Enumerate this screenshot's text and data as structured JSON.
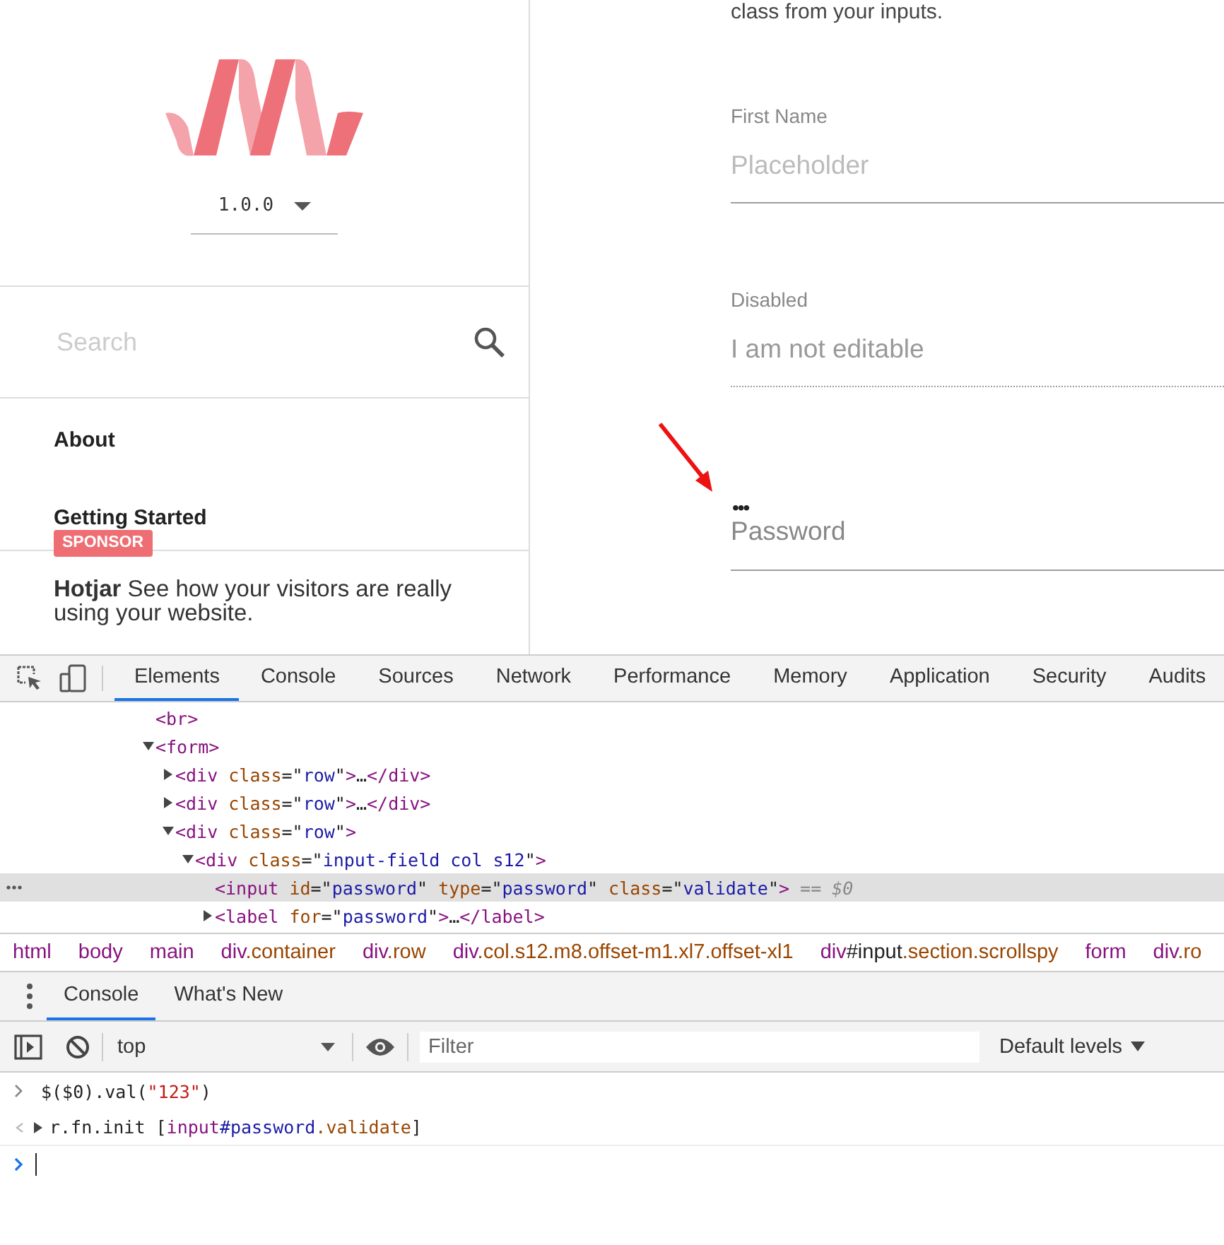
{
  "page": {
    "intro": "class from your inputs.",
    "version": "1.0.0",
    "search": {
      "placeholder": "Search"
    },
    "nav": [
      {
        "label": "About"
      },
      {
        "label": "Getting Started"
      }
    ],
    "sponsor": {
      "badge": "SPONSOR",
      "name": "Hotjar",
      "text": "See how your visitors are really using your website."
    },
    "fields": [
      {
        "kind": "text",
        "label": "First Name",
        "placeholder": "Placeholder",
        "disabled": false
      },
      {
        "kind": "text",
        "label": "Disabled",
        "value": "I am not editable",
        "disabled": true
      },
      {
        "kind": "password",
        "label": "Password",
        "value": "•••",
        "disabled": false
      }
    ]
  },
  "devtools": {
    "tabs": [
      {
        "label": "Elements",
        "selected": true
      },
      {
        "label": "Console",
        "selected": false
      },
      {
        "label": "Sources",
        "selected": false
      },
      {
        "label": "Network",
        "selected": false
      },
      {
        "label": "Performance",
        "selected": false
      },
      {
        "label": "Memory",
        "selected": false
      },
      {
        "label": "Application",
        "selected": false
      },
      {
        "label": "Security",
        "selected": false
      },
      {
        "label": "Audits",
        "selected": false
      }
    ],
    "dom": [
      {
        "selected": false,
        "tokens": [
          {
            "kind": "tag",
            "s": "<br>"
          }
        ]
      },
      {
        "selected": false,
        "expanded": true,
        "tokens": [
          {
            "kind": "tag",
            "s": "<form>"
          }
        ],
        "children": [
          {
            "selected": false,
            "expanded": false,
            "tokens": [
              {
                "kind": "tag",
                "s": "<div "
              },
              {
                "kind": "attr",
                "s": "class"
              },
              {
                "kind": "plain",
                "s": "=\""
              },
              {
                "kind": "value",
                "s": "row"
              },
              {
                "kind": "plain",
                "s": "\""
              },
              {
                "kind": "tag",
                "s": ">"
              },
              {
                "kind": "plain",
                "s": "…"
              },
              {
                "kind": "tag",
                "s": "</div>"
              }
            ]
          },
          {
            "selected": false,
            "expanded": false,
            "tokens": [
              {
                "kind": "tag",
                "s": "<div "
              },
              {
                "kind": "attr",
                "s": "class"
              },
              {
                "kind": "plain",
                "s": "=\""
              },
              {
                "kind": "value",
                "s": "row"
              },
              {
                "kind": "plain",
                "s": "\""
              },
              {
                "kind": "tag",
                "s": ">"
              },
              {
                "kind": "plain",
                "s": "…"
              },
              {
                "kind": "tag",
                "s": "</div>"
              }
            ]
          },
          {
            "selected": false,
            "expanded": true,
            "tokens": [
              {
                "kind": "tag",
                "s": "<div "
              },
              {
                "kind": "attr",
                "s": "class"
              },
              {
                "kind": "plain",
                "s": "=\""
              },
              {
                "kind": "value",
                "s": "row"
              },
              {
                "kind": "plain",
                "s": "\""
              },
              {
                "kind": "tag",
                "s": ">"
              }
            ],
            "children": [
              {
                "selected": false,
                "expanded": true,
                "tokens": [
                  {
                    "kind": "tag",
                    "s": "<div "
                  },
                  {
                    "kind": "attr",
                    "s": "class"
                  },
                  {
                    "kind": "plain",
                    "s": "=\""
                  },
                  {
                    "kind": "value",
                    "s": "input-field col s12"
                  },
                  {
                    "kind": "plain",
                    "s": "\""
                  },
                  {
                    "kind": "tag",
                    "s": ">"
                  }
                ],
                "children": [
                  {
                    "selected": true,
                    "tokens": [
                      {
                        "kind": "tag",
                        "s": "<input "
                      },
                      {
                        "kind": "attr",
                        "s": "id"
                      },
                      {
                        "kind": "plain",
                        "s": "=\""
                      },
                      {
                        "kind": "value",
                        "s": "password"
                      },
                      {
                        "kind": "plain",
                        "s": "\" "
                      },
                      {
                        "kind": "attr",
                        "s": "type"
                      },
                      {
                        "kind": "plain",
                        "s": "=\""
                      },
                      {
                        "kind": "value",
                        "s": "password"
                      },
                      {
                        "kind": "plain",
                        "s": "\" "
                      },
                      {
                        "kind": "attr",
                        "s": "class"
                      },
                      {
                        "kind": "plain",
                        "s": "=\""
                      },
                      {
                        "kind": "value",
                        "s": "validate"
                      },
                      {
                        "kind": "plain",
                        "s": "\""
                      },
                      {
                        "kind": "tag",
                        "s": ">"
                      },
                      {
                        "kind": "ref",
                        "s": " == $0"
                      }
                    ]
                  },
                  {
                    "selected": false,
                    "expanded": false,
                    "tokens": [
                      {
                        "kind": "tag",
                        "s": "<label "
                      },
                      {
                        "kind": "attr",
                        "s": "for"
                      },
                      {
                        "kind": "plain",
                        "s": "=\""
                      },
                      {
                        "kind": "value",
                        "s": "password"
                      },
                      {
                        "kind": "plain",
                        "s": "\""
                      },
                      {
                        "kind": "tag",
                        "s": ">"
                      },
                      {
                        "kind": "plain",
                        "s": "…"
                      },
                      {
                        "kind": "tag",
                        "s": "</label>"
                      }
                    ]
                  }
                ]
              }
            ]
          }
        ]
      }
    ],
    "crumbs": [
      [
        {
          "kind": "tag",
          "s": "html"
        }
      ],
      [
        {
          "kind": "tag",
          "s": "body"
        }
      ],
      [
        {
          "kind": "tag",
          "s": "main"
        }
      ],
      [
        {
          "kind": "tag",
          "s": "div"
        },
        {
          "kind": "attr",
          "s": ".container"
        }
      ],
      [
        {
          "kind": "tag",
          "s": "div"
        },
        {
          "kind": "attr",
          "s": ".row"
        }
      ],
      [
        {
          "kind": "tag",
          "s": "div"
        },
        {
          "kind": "attr",
          "s": ".col.s12.m8.offset-m1.xl7.offset-xl1"
        }
      ],
      [
        {
          "kind": "tag",
          "s": "div"
        },
        {
          "kind": "plain",
          "s": "#input"
        },
        {
          "kind": "attr",
          "s": ".section.scrollspy"
        }
      ],
      [
        {
          "kind": "tag",
          "s": "form"
        }
      ],
      [
        {
          "kind": "tag",
          "s": "div"
        },
        {
          "kind": "attr",
          "s": ".ro"
        }
      ]
    ],
    "drawer_tabs": [
      {
        "label": "Console",
        "selected": true
      },
      {
        "label": "What's New",
        "selected": false
      }
    ],
    "context": "top",
    "filter": {
      "placeholder": "Filter"
    },
    "levels": "Default levels",
    "console": [
      {
        "kind": "input",
        "tokens": [
          {
            "kind": "plain",
            "s": "$($0).val("
          },
          {
            "kind": "string",
            "s": "\"123\""
          },
          {
            "kind": "plain",
            "s": ")"
          }
        ]
      },
      {
        "kind": "output",
        "tokens": [
          {
            "kind": "plain",
            "s": "r.fn.init ["
          },
          {
            "kind": "tag",
            "s": "input"
          },
          {
            "kind": "value",
            "s": "#password"
          },
          {
            "kind": "attr",
            "s": ".validate"
          },
          {
            "kind": "plain",
            "s": "]"
          }
        ]
      },
      {
        "kind": "prompt"
      }
    ]
  }
}
